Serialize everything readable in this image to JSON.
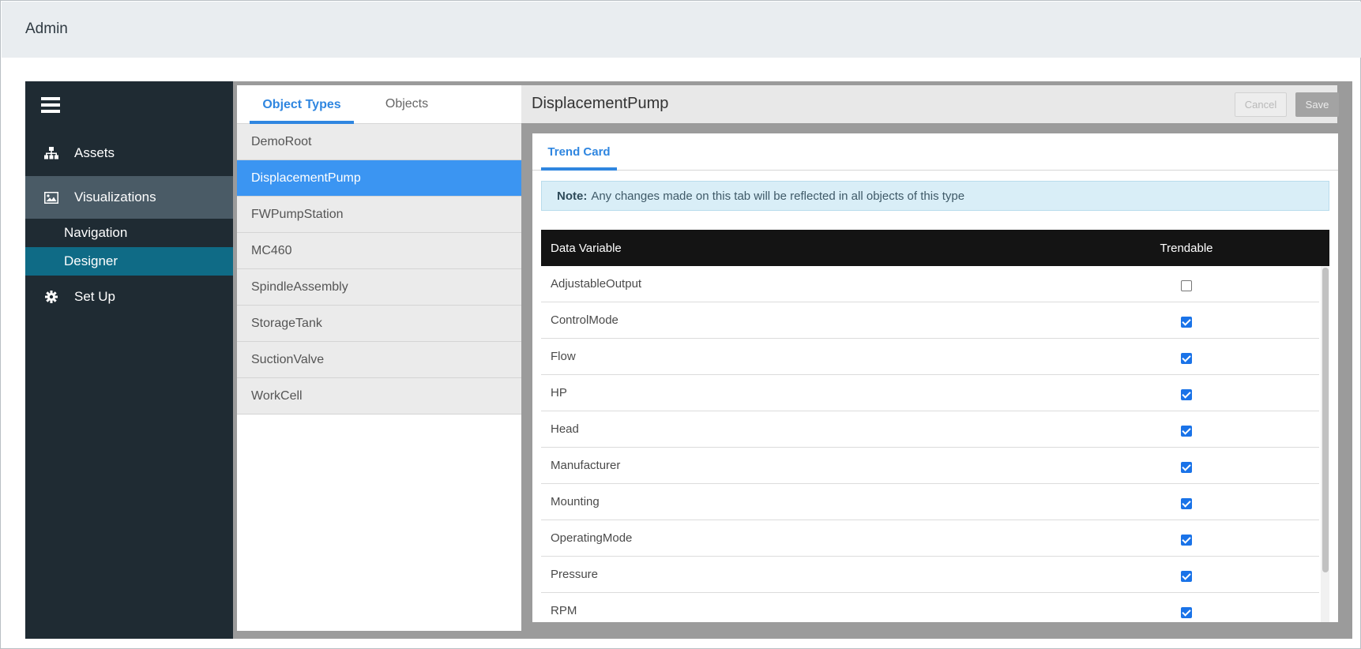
{
  "app": {
    "title": "Admin"
  },
  "sidebar": {
    "items": [
      {
        "label": "Assets",
        "icon": "sitemap-icon"
      },
      {
        "label": "Visualizations",
        "icon": "image-icon"
      },
      {
        "label": "Set Up",
        "icon": "gear-icon"
      }
    ],
    "sub_items": [
      {
        "label": "Navigation"
      },
      {
        "label": "Designer"
      }
    ],
    "active_item": "Visualizations",
    "active_sub_item": "Designer"
  },
  "list_panel": {
    "tabs": [
      {
        "label": "Object Types"
      },
      {
        "label": "Objects"
      }
    ],
    "active_tab": "Object Types",
    "object_types": [
      "DemoRoot",
      "DisplacementPump",
      "FWPumpStation",
      "MC460",
      "SpindleAssembly",
      "StorageTank",
      "SuctionValve",
      "WorkCell"
    ],
    "selected": "DisplacementPump"
  },
  "detail": {
    "title": "DisplacementPump",
    "cancel_label": "Cancel",
    "save_label": "Save",
    "tab_label": "Trend Card",
    "note_prefix": "Note:",
    "note_text": "Any changes made on this tab will be reflected in all objects of this type",
    "table": {
      "headers": [
        "Data Variable",
        "Trendable"
      ],
      "rows": [
        {
          "variable": "AdjustableOutput",
          "trendable": false
        },
        {
          "variable": "ControlMode",
          "trendable": true
        },
        {
          "variable": "Flow",
          "trendable": true
        },
        {
          "variable": "HP",
          "trendable": true
        },
        {
          "variable": "Head",
          "trendable": true
        },
        {
          "variable": "Manufacturer",
          "trendable": true
        },
        {
          "variable": "Mounting",
          "trendable": true
        },
        {
          "variable": "OperatingMode",
          "trendable": true
        },
        {
          "variable": "Pressure",
          "trendable": true
        },
        {
          "variable": "RPM",
          "trendable": true
        }
      ]
    }
  },
  "colors": {
    "accent": "#2f86e0",
    "selected_row": "#3b95f2",
    "sidebar_bg": "#1f2b33",
    "sidebar_active": "#4a5b66",
    "sidebar_sub_active": "#0f6b86"
  }
}
